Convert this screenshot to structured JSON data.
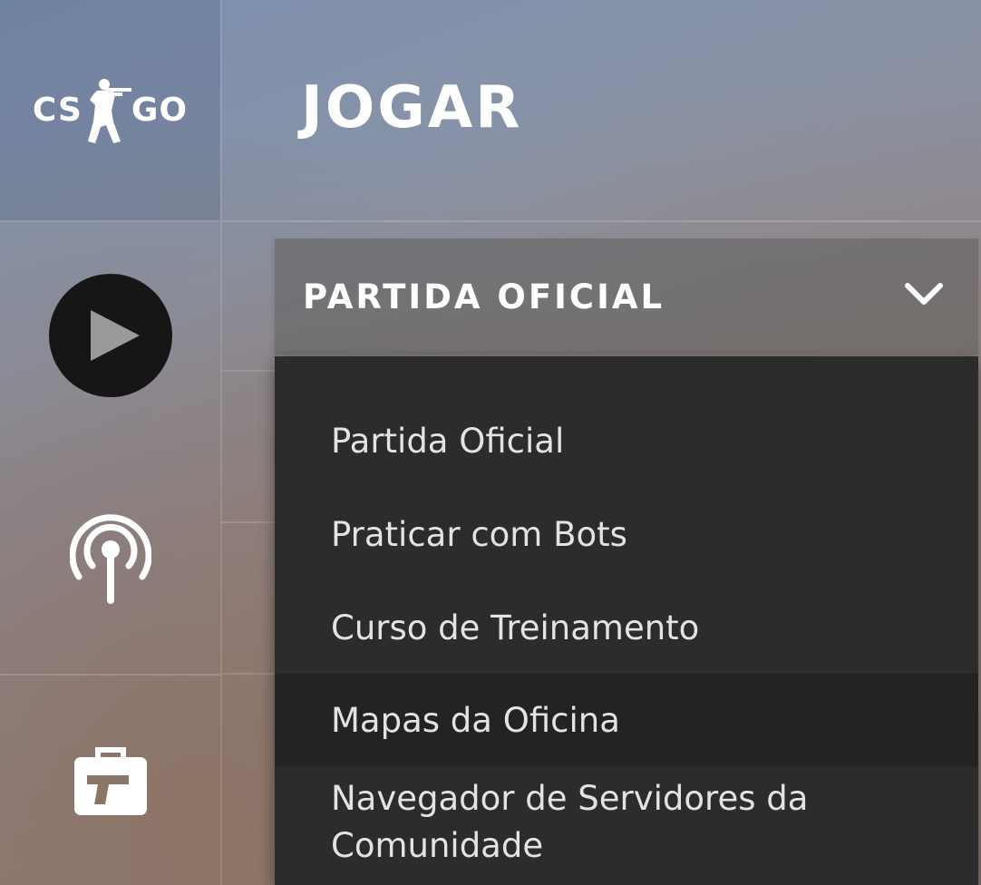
{
  "sidebar": {
    "logo": {
      "left": "CS",
      "right": "GO",
      "icon": "counter-terrorist-soldier-icon"
    },
    "items": [
      {
        "id": "play",
        "icon": "play-icon"
      },
      {
        "id": "watch",
        "icon": "broadcast-antenna-icon"
      },
      {
        "id": "inventory",
        "icon": "briefcase-pistol-icon"
      }
    ]
  },
  "header": {
    "title": "JOGAR"
  },
  "mode_select": {
    "selected_label": "PARTIDA OFICIAL",
    "icon": "chevron-down-icon",
    "options": [
      "Partida Oficial",
      "Praticar com Bots",
      "Curso de Treinamento",
      "Mapas da Oficina",
      "Navegador de Servidores da Comunidade"
    ]
  },
  "colors": {
    "menu_bg": "#2c2c2c",
    "menu_hover": "#232323",
    "play_bg": "#161616",
    "text": "#ffffff"
  }
}
